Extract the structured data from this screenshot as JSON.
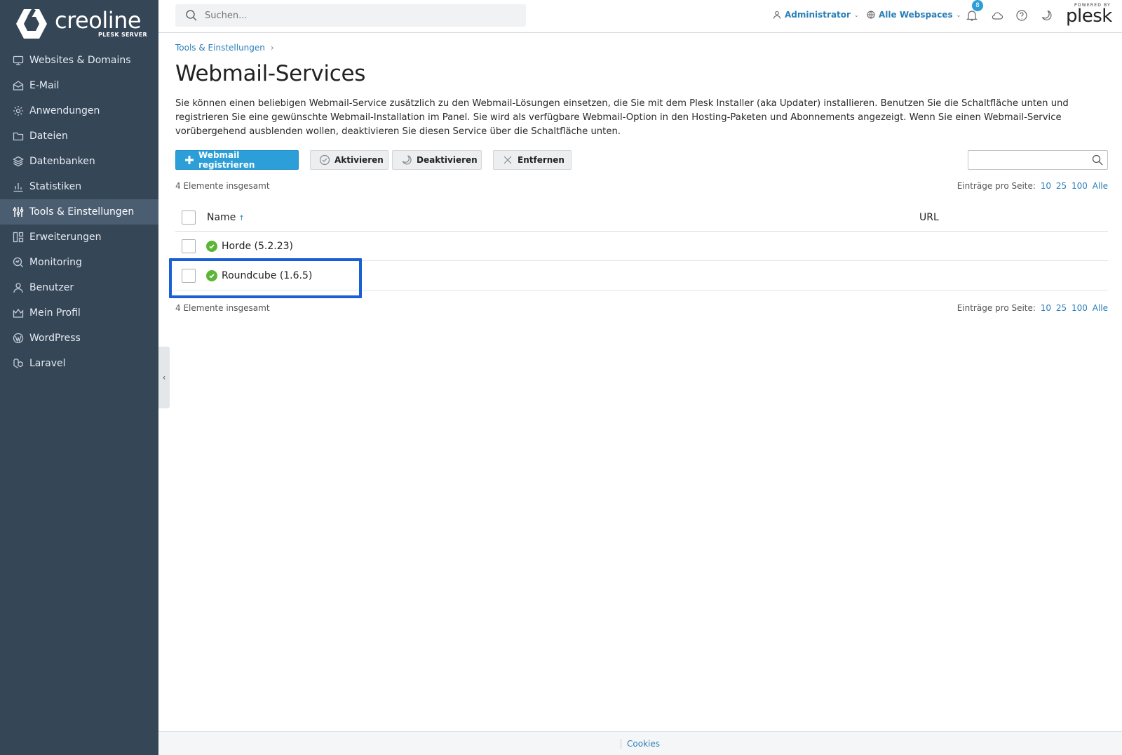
{
  "brand": {
    "name": "creoline",
    "sub": "PLESK SERVER"
  },
  "sidebar": {
    "items": [
      {
        "label": "Websites & Domains",
        "icon": "monitor-icon"
      },
      {
        "label": "E-Mail",
        "icon": "mail-icon"
      },
      {
        "label": "Anwendungen",
        "icon": "gear-icon"
      },
      {
        "label": "Dateien",
        "icon": "folder-icon"
      },
      {
        "label": "Datenbanken",
        "icon": "database-icon"
      },
      {
        "label": "Statistiken",
        "icon": "bar-chart-icon"
      },
      {
        "label": "Tools & Einstellungen",
        "icon": "sliders-icon",
        "active": true
      },
      {
        "label": "Erweiterungen",
        "icon": "extensions-icon"
      },
      {
        "label": "Monitoring",
        "icon": "monitoring-icon"
      },
      {
        "label": "Benutzer",
        "icon": "user-icon"
      },
      {
        "label": "Mein Profil",
        "icon": "crown-icon"
      },
      {
        "label": "WordPress",
        "icon": "wordpress-icon"
      },
      {
        "label": "Laravel",
        "icon": "laravel-icon"
      }
    ]
  },
  "topbar": {
    "search_placeholder": "Suchen...",
    "user_label": "Administrator",
    "webspaces_label": "Alle Webspaces",
    "notification_count": "8",
    "powered_by": "POWERED BY",
    "plesk": "plesk"
  },
  "breadcrumb": {
    "label": "Tools & Einstellungen",
    "sep": "›"
  },
  "page": {
    "title": "Webmail-Services",
    "description": "Sie können einen beliebigen Webmail-Service zusätzlich zu den Webmail-Lösungen einsetzen, die Sie mit dem Plesk Installer (aka Updater) installieren. Benutzen Sie die Schaltfläche unten und registrieren Sie eine gewünschte Webmail-Installation im Panel. Sie wird als verfügbare Webmail-Option in den Hosting-Paketen und Abonnements angezeigt. Wenn Sie einen Webmail-Service vorübergehend ausblenden wollen, deaktivieren Sie diesen Service über die Schaltfläche unten."
  },
  "toolbar": {
    "register_label": "Webmail registrieren",
    "activate_label": "Aktivieren",
    "deactivate_label": "Deaktivieren",
    "remove_label": "Entfernen"
  },
  "list": {
    "total_label": "4 Elemente insgesamt",
    "per_page_label": "Einträge pro Seite:",
    "per_page_options": [
      "10",
      "25",
      "100",
      "Alle"
    ],
    "columns": {
      "name": "Name",
      "sort_arrow": "↑",
      "url": "URL"
    },
    "rows": [
      {
        "name": "Horde (5.2.23)",
        "status": "active"
      },
      {
        "name": "Roundcube (1.6.5)",
        "status": "active"
      }
    ]
  },
  "footer": {
    "cookies": "Cookies"
  },
  "colors": {
    "sidebar": "#354657",
    "accent": "#2d9fd8",
    "status_ok": "#5bb635",
    "highlight": "#1a5fd6"
  }
}
